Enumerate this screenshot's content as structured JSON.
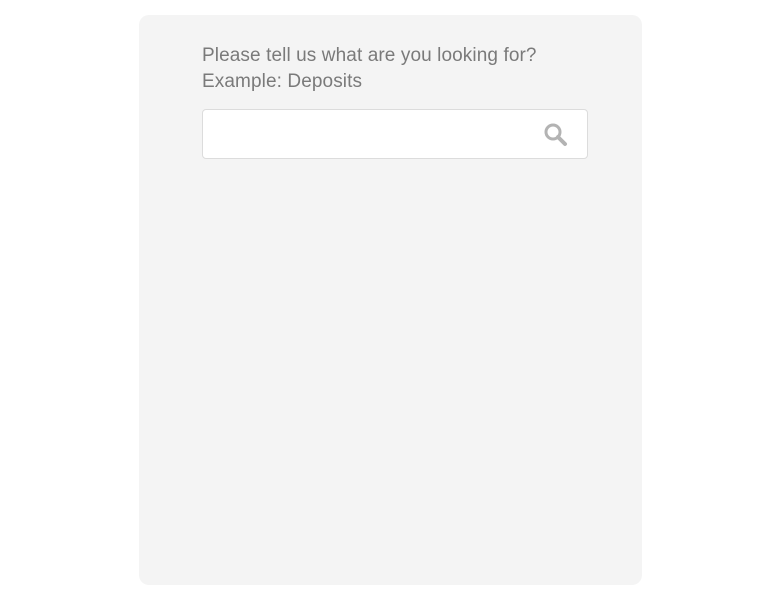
{
  "search_panel": {
    "prompt_line1": "Please tell us what are you looking for?",
    "prompt_line2": "Example: Deposits",
    "input_value": "",
    "input_placeholder": "",
    "search_icon": "magnifier-icon",
    "colors": {
      "panel_background": "#f4f4f4",
      "prompt_text": "#7a7a7a",
      "icon": "#b3b3b3",
      "input_border": "#dcdcdc"
    }
  }
}
